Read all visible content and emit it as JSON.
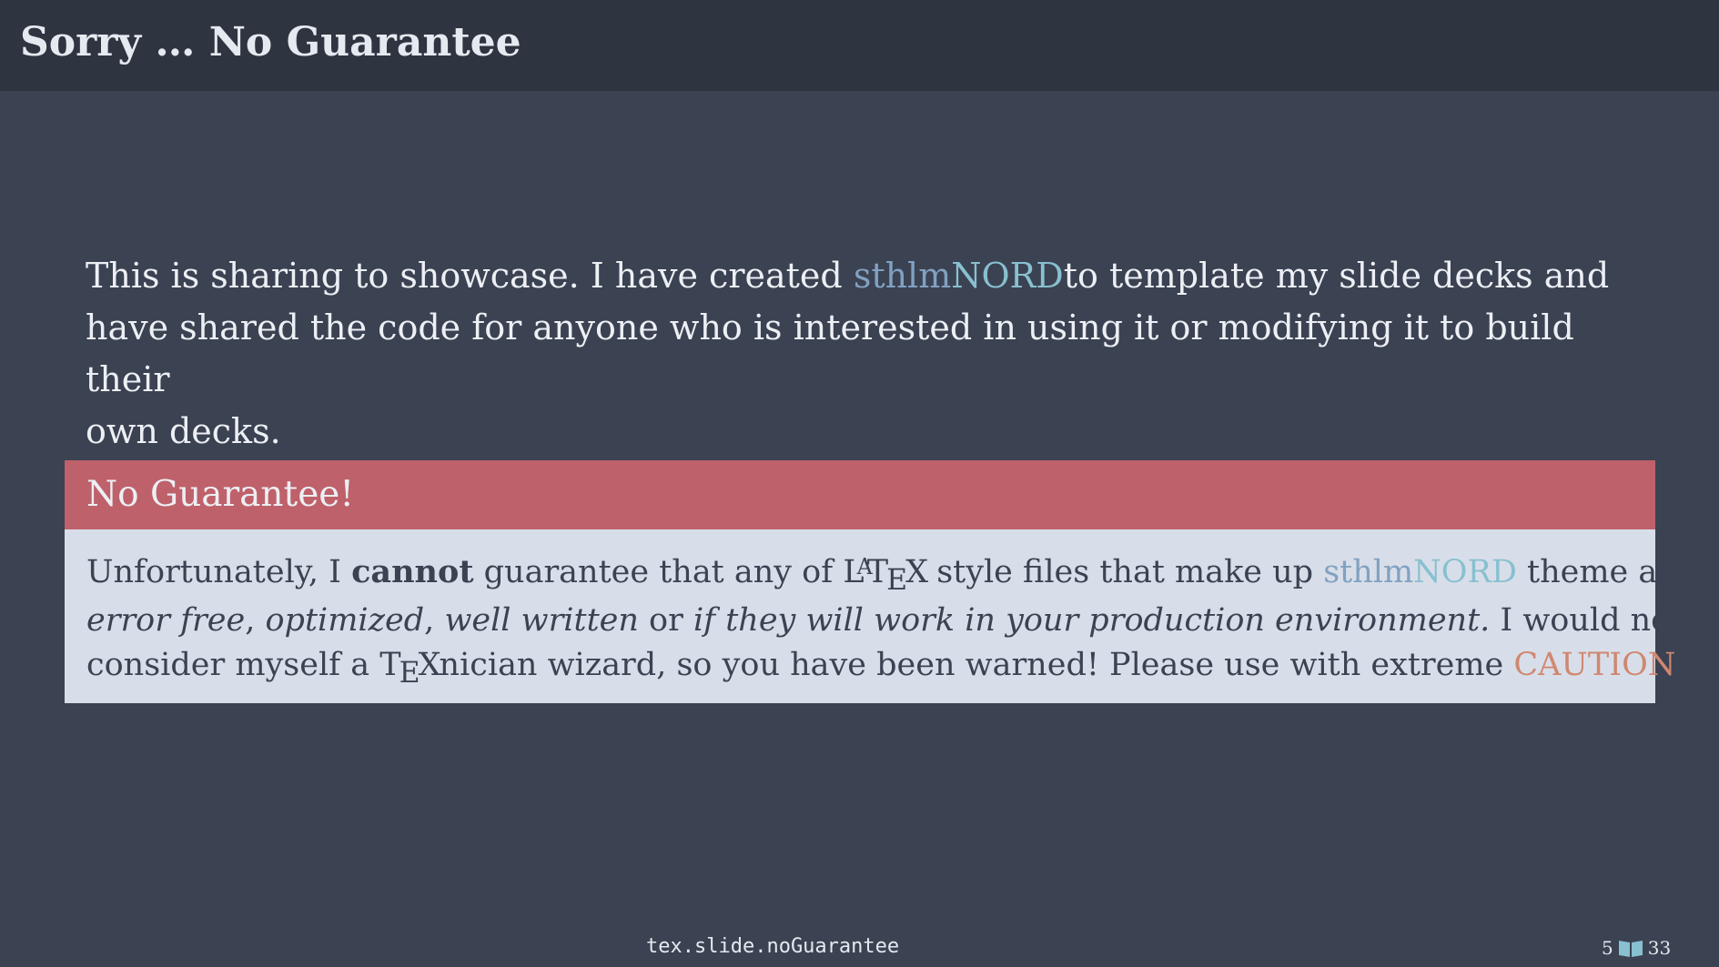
{
  "slide": {
    "title": "Sorry … No Guarantee"
  },
  "intro": {
    "before": "This is sharing to showcase. I have created ",
    "brand_sthlm": "sthlm",
    "brand_nord": "NORD",
    "after_line1": "to template my slide decks and",
    "line2": "have shared the code for anyone who is interested in using it or modifying it to build their",
    "line3": "own decks."
  },
  "alert_block": {
    "title": "No Guarantee!",
    "line1_a": "Unfortunately, I ",
    "line1_bold": "cannot",
    "line1_b": " guarantee that any of ",
    "latex_l": "L",
    "latex_a": "A",
    "latex_t": "T",
    "latex_e": "E",
    "latex_x": "X",
    "line1_c": " style files that make up ",
    "brand_sthlm": "sthlm",
    "brand_nord": "NORD",
    "line1_d": " theme are",
    "line2_i1": "error free",
    "line2_sep1": ", ",
    "line2_i2": "optimized",
    "line2_sep2": ", ",
    "line2_i3": "well written",
    "line2_sep3": " or ",
    "line2_i4": "if they will work in your production environment.",
    "line2_tail": " I would not",
    "line3_a": "consider myself a ",
    "tex_t": "T",
    "tex_e": "E",
    "tex_x": "X",
    "line3_b": "nician wizard, so you have been warned! Please use with extreme ",
    "caution": "CAUTION",
    "line3_end": "."
  },
  "footer": {
    "label": "tex.slide.noGuarantee",
    "page_current": "5",
    "page_total": "33",
    "icon": "book-icon"
  },
  "colors": {
    "background": "#3b4252",
    "title_bar": "#2e3440",
    "alert": "#bf616a",
    "block_body": "#d8dee9",
    "brand_sthlm": "#81a1c1",
    "brand_nord": "#88c0d0",
    "caution": "#d08770"
  }
}
